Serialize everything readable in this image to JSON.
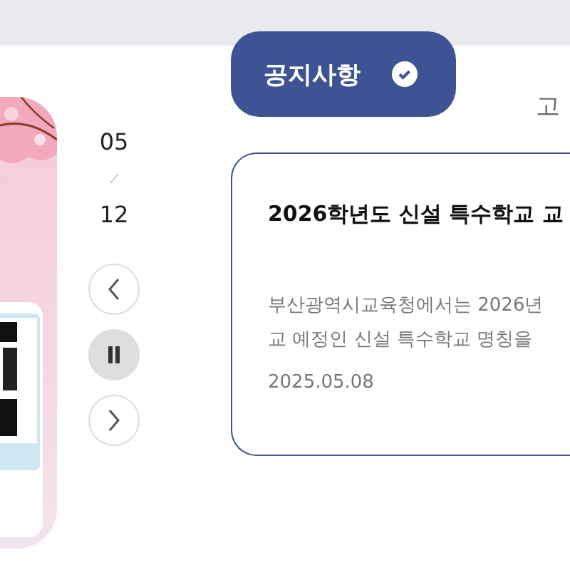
{
  "slide_counter": {
    "current": "05",
    "total": "12"
  },
  "tabs": [
    {
      "label": "공지사항",
      "selected": true
    },
    {
      "label": "고",
      "selected": false
    }
  ],
  "notice": {
    "title": "2026학년도 신설 특수학교 교",
    "body_lines": [
      "부산광역시교육청에서는 2026년",
      "교 예정인 신설 특수학교 명칭을"
    ],
    "date": "2025.05.08"
  }
}
